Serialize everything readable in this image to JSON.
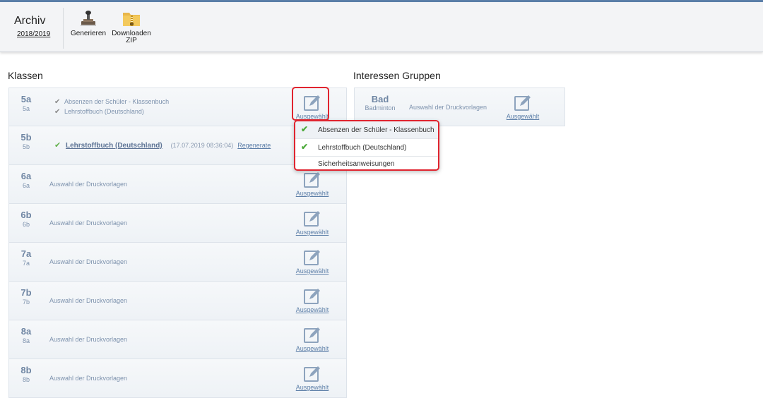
{
  "header": {
    "title": "Archiv",
    "year": "2018/2019",
    "buttons": [
      {
        "label": "Generieren",
        "icon": "stamp-icon"
      },
      {
        "label_line1": "Downloaden",
        "label_line2": "ZIP",
        "icon": "zip-folder-icon"
      }
    ]
  },
  "sections": {
    "klassen": "Klassen",
    "interessen": "Interessen Gruppen"
  },
  "edit_label": "Ausgewählt",
  "classes": [
    {
      "name": "5a",
      "sub": "5a",
      "docs": [
        "Absenzen der Schüler - Klassenbuch",
        "Lehrstoffbuch (Deutschland)"
      ]
    },
    {
      "name": "5b",
      "sub": "5b",
      "doc": "Lehrstoffbuch (Deutschland)",
      "timestamp": "(17.07.2019 08:36:04)",
      "action": "Regenerate"
    },
    {
      "name": "6a",
      "sub": "6a",
      "link": "Auswahl der Druckvorlagen"
    },
    {
      "name": "6b",
      "sub": "6b",
      "link": "Auswahl der Druckvorlagen"
    },
    {
      "name": "7a",
      "sub": "7a",
      "link": "Auswahl der Druckvorlagen"
    },
    {
      "name": "7b",
      "sub": "7b",
      "link": "Auswahl der Druckvorlagen"
    },
    {
      "name": "8a",
      "sub": "8a",
      "link": "Auswahl der Druckvorlagen"
    },
    {
      "name": "8b",
      "sub": "8b",
      "link": "Auswahl der Druckvorlagen"
    }
  ],
  "interest_groups": [
    {
      "name": "Bad",
      "sub": "Badminton",
      "link": "Auswahl der Druckvorlagen"
    }
  ],
  "dropdown": {
    "items": [
      {
        "label": "Absenzen der Schüler - Klassenbuch",
        "checked": true
      },
      {
        "label": "Lehrstoffbuch (Deutschland)",
        "checked": true
      },
      {
        "label": "Sicherheitsanweisungen",
        "checked": false
      }
    ]
  },
  "colors": {
    "accent": "#5a7ea8",
    "highlight": "#e0242f",
    "check": "#4caa3a"
  }
}
